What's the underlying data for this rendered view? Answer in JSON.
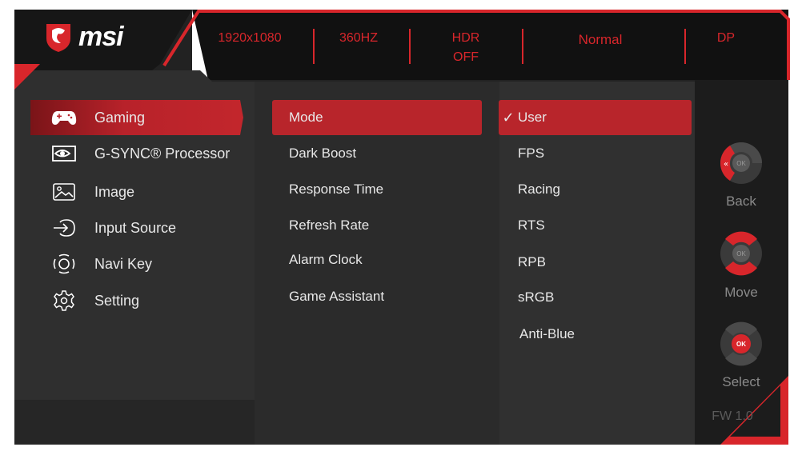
{
  "brand": {
    "logo_text": "msi"
  },
  "status_bar": [
    {
      "id": "resolution",
      "text": "1920x1080"
    },
    {
      "id": "refresh",
      "text": "360HZ"
    },
    {
      "id": "hdr",
      "text": "HDR\nOFF"
    },
    {
      "id": "mode",
      "text": "Normal"
    },
    {
      "id": "input",
      "text": "DP"
    }
  ],
  "main_menu": [
    {
      "label": "Gaming",
      "icon": "gamepad-icon",
      "active": true
    },
    {
      "label": "G-SYNC® Processor",
      "icon": "nvidia-icon",
      "active": false
    },
    {
      "label": "Image",
      "icon": "image-icon",
      "active": false
    },
    {
      "label": "Input Source",
      "icon": "input-source-icon",
      "active": false
    },
    {
      "label": "Navi Key",
      "icon": "navi-key-icon",
      "active": false
    },
    {
      "label": "Setting",
      "icon": "gear-icon",
      "active": false
    }
  ],
  "sub_menu": [
    {
      "label": "Mode",
      "active": true
    },
    {
      "label": "Dark Boost",
      "active": false
    },
    {
      "label": "Response Time",
      "active": false
    },
    {
      "label": "Refresh Rate",
      "active": false
    },
    {
      "label": "Alarm Clock",
      "active": false
    },
    {
      "label": "Game Assistant",
      "active": false
    }
  ],
  "options": [
    {
      "label": "User",
      "active": true,
      "check": "✓"
    },
    {
      "label": "FPS",
      "active": false
    },
    {
      "label": "Racing",
      "active": false
    },
    {
      "label": "RTS",
      "active": false
    },
    {
      "label": "RPB",
      "active": false
    },
    {
      "label": "sRGB",
      "active": false
    },
    {
      "label": "Anti-Blue",
      "active": false
    }
  ],
  "nav_hints": [
    {
      "label": "Back",
      "icon": "joystick-back-icon",
      "center": "OK"
    },
    {
      "label": "Move",
      "icon": "joystick-move-icon",
      "center": "OK"
    },
    {
      "label": "Select",
      "icon": "joystick-select-icon",
      "center": "OK"
    }
  ],
  "firmware": "FW 1.0",
  "colors": {
    "accent": "#d8262b",
    "panel": "#2d2d2d",
    "highlight": "#b8252b"
  }
}
